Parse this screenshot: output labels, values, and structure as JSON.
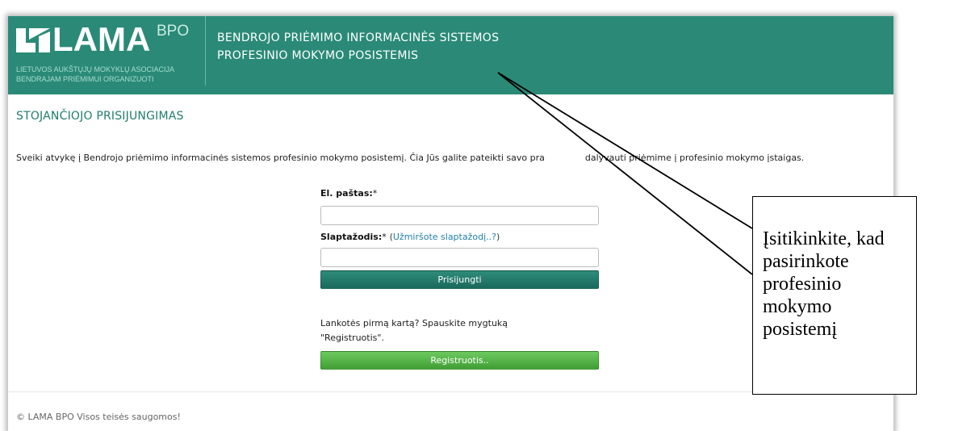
{
  "header": {
    "logo_text": "LAMA",
    "logo_sup": "BPO",
    "logo_sub_line1": "Lietuvos aukštųjų mokyklų asociacija",
    "logo_sub_line2": "bendrajam priėmimui organizuoti",
    "title_line1": "BENDROJO PRIĖMIMO INFORMACINĖS SISTEMOS",
    "title_line2": "PROFESINIO MOKYMO POSISTEMIS"
  },
  "page": {
    "title": "STOJANČIOJO PRISIJUNGIMAS",
    "welcome": "Sveiki atvykę į Bendrojo priėmimo informacinės sistemos profesinio mokymo posistemį. Čia Jūs galite pateikti savo pra",
    "welcome_tail": "dalyvauti priėmime į profesinio mokymo įstaigas."
  },
  "login_form": {
    "email_label": "El. paštas:",
    "password_label": "Slaptažodis:",
    "required_mark": "*",
    "forgot_link": "Užmiršote slaptažodį..?",
    "email_value": "",
    "password_value": "",
    "login_button": "Prisijungti",
    "first_visit_line1": "Lankotės pirmą kartą? Spauskite mygtuką",
    "first_visit_line2": "\"Registruotis\".",
    "register_button": "Registruotis.."
  },
  "footer": {
    "text": "© LAMA BPO Visos teisės saugomos!"
  },
  "callout": {
    "lines": [
      "Įsitikinkite, kad",
      "pasirinkote",
      "profesinio",
      "mokymo",
      "posistemį"
    ]
  },
  "colors": {
    "header_bg": "#2a8a77",
    "accent": "#1f7d6d",
    "link": "#1f7fa8",
    "register_button": "#4fae42"
  }
}
